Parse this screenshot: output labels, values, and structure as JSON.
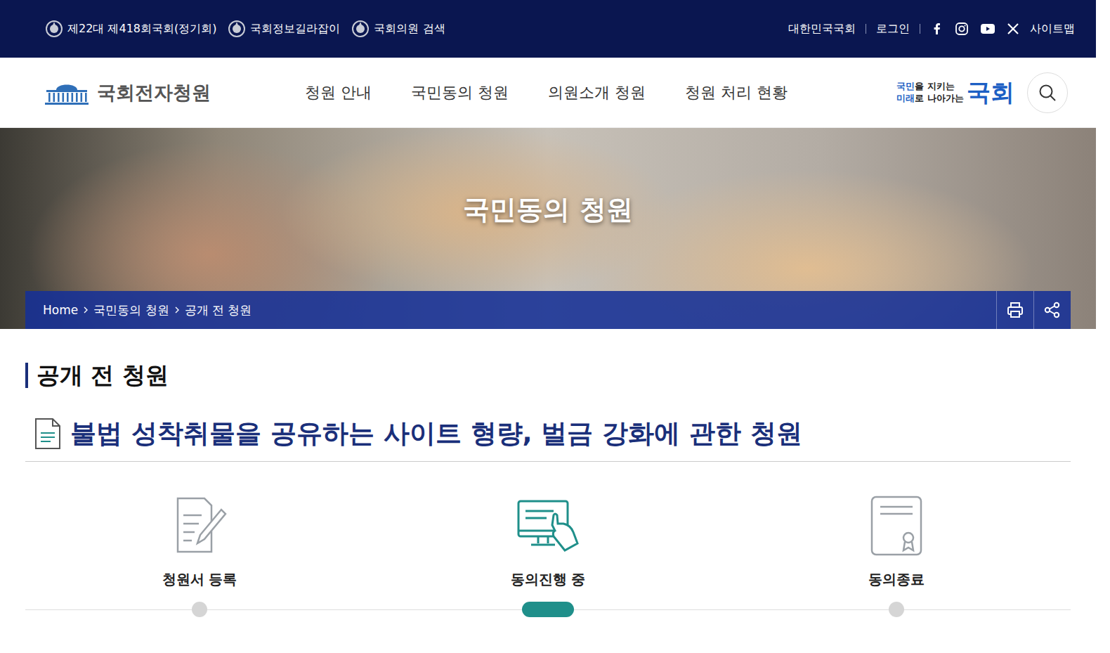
{
  "top_bar": {
    "left_links": [
      "제22대 제418회국회(정기회)",
      "국회정보길라잡이",
      "국회의원 검색"
    ],
    "right_links": [
      "대한민국국회",
      "로그인"
    ],
    "sitemap": "사이트맵"
  },
  "header": {
    "logo": "국회전자청원",
    "nav": [
      "청원 안내",
      "국민동의 청원",
      "의원소개 청원",
      "청원 처리 현황"
    ],
    "slogan": {
      "line1_highlight": "국민",
      "line1": "을 지키는",
      "line2_highlight": "미래",
      "line2": "로 나아가는",
      "mark": "국회"
    }
  },
  "hero": {
    "title": "국민동의 청원",
    "breadcrumb": [
      "Home",
      "국민동의 청원",
      "공개 전 청원"
    ]
  },
  "section_title": "공개 전 청원",
  "petition": {
    "title": "불법 성착취물을 공유하는 사이트 형량, 벌금 강화에 관한 청원"
  },
  "steps": [
    {
      "label": "청원서 등록",
      "selected": false
    },
    {
      "label": "동의진행 중",
      "selected": true
    },
    {
      "label": "동의종료",
      "selected": false
    }
  ]
}
